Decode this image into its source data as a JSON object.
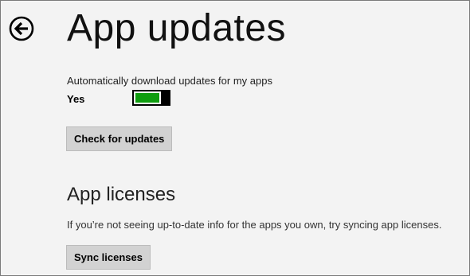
{
  "page": {
    "title": "App updates",
    "back_icon": "back-arrow-circle-icon"
  },
  "auto_update": {
    "label": "Automatically download updates for my apps",
    "state_label": "Yes",
    "enabled": true,
    "accent_color": "#0f9d0f"
  },
  "buttons": {
    "check_updates": "Check for updates",
    "sync_licenses": "Sync licenses"
  },
  "licenses": {
    "title": "App licenses",
    "description": "If you’re not seeing up-to-date info for the apps you own, try syncing app licenses."
  }
}
